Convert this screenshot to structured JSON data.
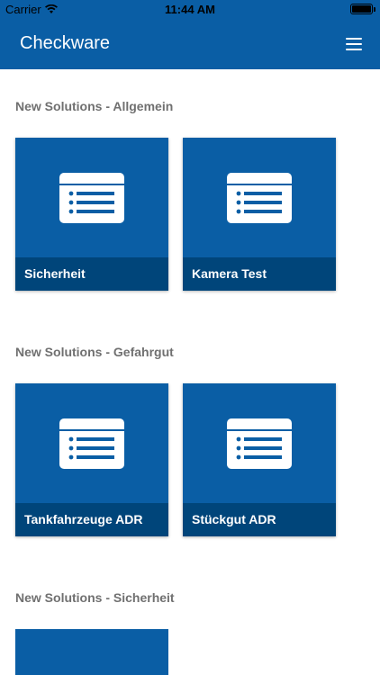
{
  "status_bar": {
    "carrier": "Carrier",
    "time": "11:44 AM"
  },
  "app_bar": {
    "title": "Checkware",
    "menu_icon": "hamburger-menu-icon"
  },
  "sections": [
    {
      "title": "New Solutions - Allgemein",
      "tiles": [
        {
          "label": "Sicherheit"
        },
        {
          "label": "Kamera Test"
        }
      ]
    },
    {
      "title": "New Solutions - Gefahrgut",
      "tiles": [
        {
          "label": "Tankfahrzeuge ADR"
        },
        {
          "label": "Stückgut ADR"
        }
      ]
    },
    {
      "title": "New Solutions - Sicherheit",
      "tiles": [
        {
          "label": ""
        }
      ]
    }
  ],
  "colors": {
    "primary": "#0a5ea5",
    "tile_label_bg": "#00457a",
    "section_title": "#707070"
  }
}
